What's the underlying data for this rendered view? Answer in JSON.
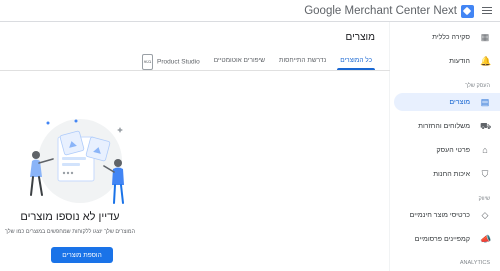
{
  "header": {
    "app_name": "Google Merchant Center Next",
    "menu_icon": "hamburger-menu-icon"
  },
  "sidebar": {
    "items": [
      {
        "label": "סקירה כללית",
        "icon": "overview-icon"
      },
      {
        "label": "הודעות",
        "icon": "bell-icon"
      }
    ],
    "section_business": "העסק שלך",
    "business_items": [
      {
        "label": "מוצרים",
        "icon": "products-icon",
        "active": true
      },
      {
        "label": "משלוחים והחזרות",
        "icon": "truck-icon"
      },
      {
        "label": "פרטי העסק",
        "icon": "store-icon"
      },
      {
        "label": "איכות החנות",
        "icon": "shield-icon"
      }
    ],
    "section_growth": "שיווק",
    "growth_items": [
      {
        "label": "כרטיסי מוצר חינמיים",
        "icon": "tag-icon"
      },
      {
        "label": "קמפיינים פרסומיים",
        "icon": "megaphone-icon"
      }
    ],
    "section_analytics": "ANALYTICS"
  },
  "main": {
    "title": "מוצרים",
    "tabs": [
      {
        "label": "כל המוצרים",
        "active": true
      },
      {
        "label": "נדרשת התייחסות"
      },
      {
        "label": "שיפורים אוטומטיים"
      },
      {
        "label": "Product Studio",
        "badge": "בטא"
      }
    ],
    "empty_state": {
      "title": "עדיין לא נוספו מוצרים",
      "subtitle": "המוצרים שלך יוצגו ללקוחות שמחפשים במוצרים כמו שלך",
      "button_label": "הוספת מוצרים"
    }
  },
  "colors": {
    "accent": "#1a73e8",
    "active_bg": "#e8f0fe",
    "active_text": "#1967d2"
  }
}
